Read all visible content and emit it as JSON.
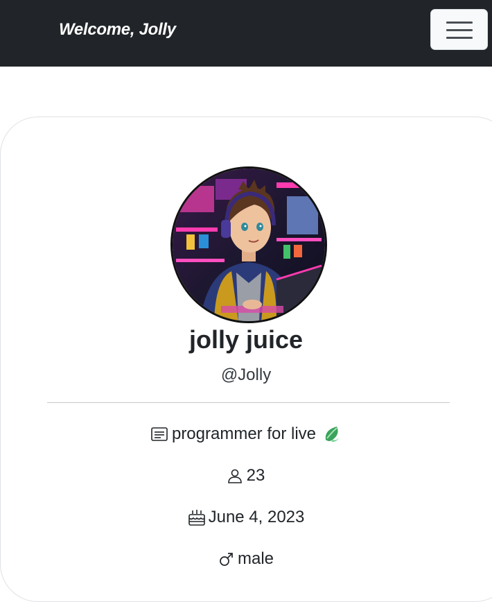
{
  "header": {
    "brand": "Welcome, Jolly",
    "menu_icon": "hamburger-icon"
  },
  "profile": {
    "avatar_icon": "avatar-image",
    "display_name": "jolly juice",
    "username": "@Jolly",
    "bio": "programmer for live",
    "bio_icon": "card-text-icon",
    "bio_emoji_icon": "leaf-icon",
    "age": "23",
    "age_icon": "person-icon",
    "birthday": "June 4, 2023",
    "birthday_icon": "cake-icon",
    "gender": "male",
    "gender_icon": "male-symbol-icon"
  },
  "colors": {
    "navbar_bg": "#212529",
    "leaf_green": "#3aa35a"
  }
}
